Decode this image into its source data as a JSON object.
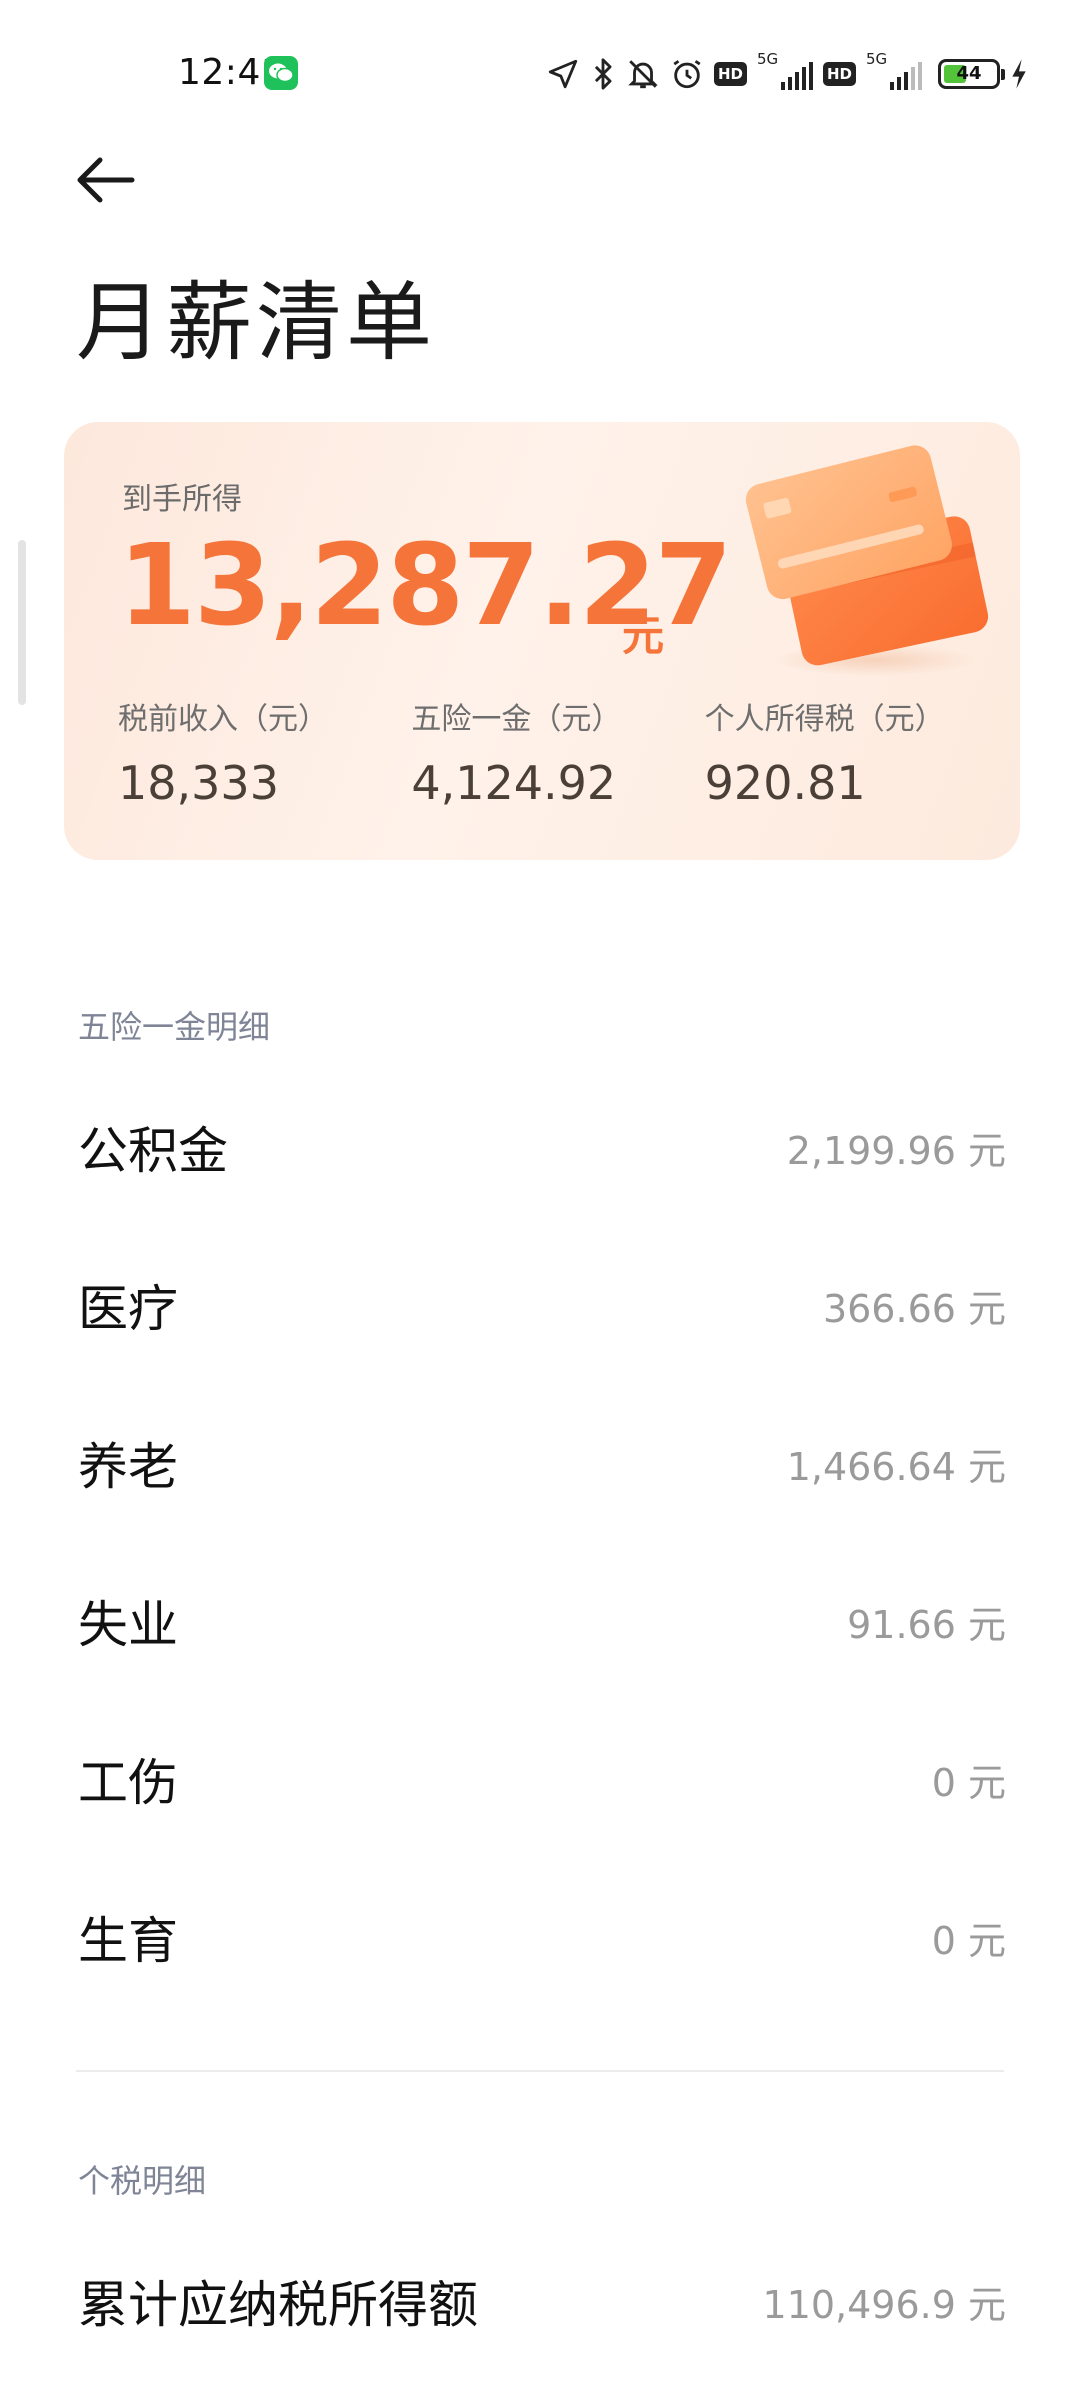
{
  "status_bar": {
    "time": "12:41",
    "network_1": "5G",
    "network_2": "5G",
    "hd_label": "HD",
    "battery_level": "44",
    "battery_percent": 44
  },
  "header": {
    "title": "月薪清单"
  },
  "summary": {
    "take_home_label": "到手所得",
    "take_home_amount": "13,287.27",
    "unit": "元",
    "stats": [
      {
        "label": "税前收入（元）",
        "value": "18,333"
      },
      {
        "label": "五险一金（元）",
        "value": "4,124.92"
      },
      {
        "label": "个人所得税（元）",
        "value": "920.81"
      }
    ]
  },
  "insurance_section": {
    "title": "五险一金明细",
    "items": [
      {
        "label": "公积金",
        "value": "2,199.96 元"
      },
      {
        "label": "医疗",
        "value": "366.66 元"
      },
      {
        "label": "养老",
        "value": "1,466.64 元"
      },
      {
        "label": "失业",
        "value": "91.66 元"
      },
      {
        "label": "工伤",
        "value": "0 元"
      },
      {
        "label": "生育",
        "value": "0 元"
      }
    ]
  },
  "tax_section": {
    "title": "个税明细",
    "items": [
      {
        "label": "累计应纳税所得额",
        "value": "110,496.9 元"
      }
    ]
  },
  "colors": {
    "accent": "#f5743a",
    "card_bg": "#fdeee4",
    "section_title": "#7f8596"
  }
}
